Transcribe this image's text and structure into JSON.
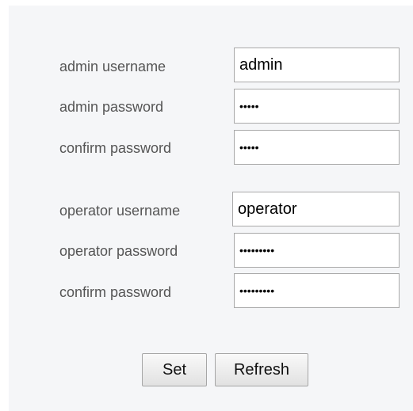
{
  "admin": {
    "username_label": "admin username",
    "username_value": "admin",
    "password_label": "admin password",
    "password_value": "admin",
    "confirm_label": "confirm password",
    "confirm_value": "admin"
  },
  "operator": {
    "username_label": "operator username",
    "username_value": "operator",
    "password_label": "operator password",
    "password_value": "operator1",
    "confirm_label": "confirm password",
    "confirm_value": "operator1"
  },
  "buttons": {
    "set_label": "Set",
    "refresh_label": "Refresh"
  }
}
